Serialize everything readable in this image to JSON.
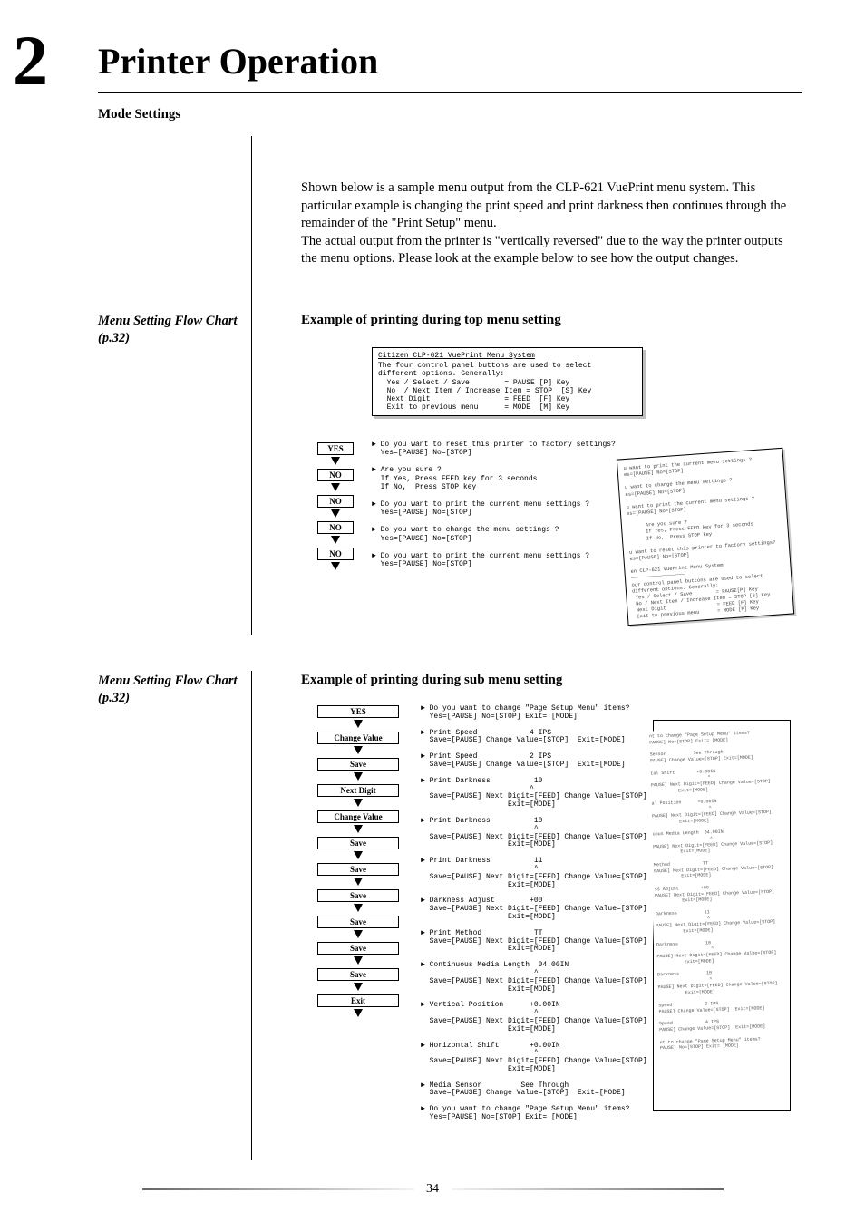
{
  "chapter_number": "2",
  "chapter_title": "Printer Operation",
  "section_title": "Mode Settings",
  "intro_para1": "Shown below is a sample menu output from the CLP-621 VuePrint menu system. This particular example is changing the print speed and print darkness then continues through the remainder of the \"Print Setup\" menu.",
  "intro_para2": "The actual output from the printer is \"vertically reversed\" due to the way the printer outputs the menu options. Please look at the example below to see how the output changes.",
  "sidebar_ref_top": "Menu Setting Flow Chart (p.32)",
  "sidebar_ref_bottom": "Menu Setting Flow Chart (p.32)",
  "example_heading_1": "Example of printing during top menu setting",
  "example_heading_2": "Example of printing during sub menu setting",
  "box1_title": "Citizen CLP-621 VuePrint Menu System",
  "box1_body": "The four control panel buttons are used to select\ndifferent options. Generally:\n  Yes / Select / Save        = PAUSE [P] Key\n  No  / Next Item / Increase Item = STOP  [S] Key\n  Next Digit                 = FEED  [F] Key\n  Exit to previous menu      = MODE  [M] Key",
  "d1_labels": [
    "YES",
    "NO",
    "NO",
    "NO",
    "NO"
  ],
  "d1_flow": [
    "Do you want to reset this printer to factory settings?\n  Yes=[PAUSE] No=[STOP]",
    "Are you sure ?\n  If Yes, Press FEED key for 3 seconds\n  If No,  Press STOP key",
    "Do you want to print the current menu settings ?\n  Yes=[PAUSE] No=[STOP]",
    "Do you want to change the menu settings ?\n  Yes=[PAUSE] No=[STOP]",
    "Do you want to print the current menu settings ?\n  Yes=[PAUSE] No=[STOP]"
  ],
  "d1_thumb": "u want to print the current menu settings ?\nes=[PAUSE] No=[STOP]\n\nu want to change the menu settings ?\nes=[PAUSE] No=[STOP]\n\nu want to print the current menu settings ?\nes=[PAUSE] No=[STOP]\n\n      Are you sure ?\n      If Yes, Press FEED key for 3 seconds\n      If No,  Press STOP key\n\nu want to reset this printer to factory settings?\nes=[PAUSE] No=[STOP]\n\nen CLP-621 VuePrint Menu System\n――――――――――――――――――\nour control panel buttons are used to select\ndifferent options. Generally:\n Yes / Select / Save        = PAUSE[P] Key\n No / Next Item / Increase Item = STOP [S] Key\n Next Digit                 = FEED [F] Key\n Exit to previous menu      = MODE [M] Key",
  "d2_labels": [
    "YES",
    "Change Value",
    "Save",
    "Next Digit",
    "Change Value",
    "Save",
    "Save",
    "Save",
    "Save",
    "Save",
    "Save",
    "Exit"
  ],
  "d2_flow": [
    "Do you want to change \"Page Setup Menu\" items?\n  Yes=[PAUSE] No=[STOP] Exit= [MODE]",
    "Print Speed            4 IPS\n  Save=[PAUSE] Change Value=[STOP]  Exit=[MODE]",
    "Print Speed            2 IPS\n  Save=[PAUSE] Change Value=[STOP]  Exit=[MODE]",
    "Print Darkness          10\n                         ^\n  Save=[PAUSE] Next Digit=[FEED] Change Value=[STOP]\n                    Exit=[MODE]",
    "Print Darkness          10\n                          ^\n  Save=[PAUSE] Next Digit=[FEED] Change Value=[STOP]\n                    Exit=[MODE]",
    "Print Darkness          11\n                          ^\n  Save=[PAUSE] Next Digit=[FEED] Change Value=[STOP]\n                    Exit=[MODE]",
    "Darkness Adjust        +00\n  Save=[PAUSE] Next Digit=[FEED] Change Value=[STOP]\n                    Exit=[MODE]",
    "Print Method            TT\n  Save=[PAUSE] Next Digit=[FEED] Change Value=[STOP]\n                    Exit=[MODE]",
    "Continuous Media Length  04.00IN\n                          ^\n  Save=[PAUSE] Next Digit=[FEED] Change Value=[STOP]\n                    Exit=[MODE]",
    "Vertical Position      +0.00IN\n                          ^\n  Save=[PAUSE] Next Digit=[FEED] Change Value=[STOP]\n                    Exit=[MODE]",
    "Horizontal Shift       +0.00IN\n                          ^\n  Save=[PAUSE] Next Digit=[FEED] Change Value=[STOP]\n                    Exit=[MODE]",
    "Media Sensor         See Through\n  Save=[PAUSE] Change Value=[STOP]  Exit=[MODE]",
    "Do you want to change \"Page Setup Menu\" items?\n  Yes=[PAUSE] No=[STOP] Exit= [MODE]"
  ],
  "d2_thumb": "nt to change \"Page Setup Menu\" items?\nPAUSE] No=[STOP] Exit= [MODE]\n\nSensor          See Through\nPAUSE] Change Value=[STOP] Exit=[MODE]\n\ntal Shift        +0.00IN\n                     ^\nPAUSE] Next Digit=[FEED] Change Value=[STOP]\n          Exit=[MODE]\n\nal Position      +0.00IN\n                     ^\nPAUSE] Next Digit=[FEED] Change Value=[STOP]\n          Exit=[MODE]\n\nuous Media Length  04.00IN\n                     ^\nPAUSE] Next Digit=[FEED] Change Value=[STOP]\n          Exit=[MODE]\n\nMethod            TT\nPAUSE] Next Digit=[FEED] Change Value=[STOP]\n          Exit=[MODE]\n\nss Adjust        +00\nPAUSE] Next Digit=[FEED] Change Value=[STOP]\n          Exit=[MODE]\n\nDarkness          11\n                   ^\nPAUSE] Next Digit=[FEED] Change Value=[STOP]\n          Exit=[MODE]\n\nDarkness          10\n                    ^\nPAUSE] Next Digit=[FEED] Change Value=[STOP]\n          Exit=[MODE]\n\nDarkness          10\n                   ^\nPAUSE] Next Digit=[FEED] Change Value=[STOP]\n          Exit=[MODE]\n\nSpeed            2 IPS\nPAUSE] Change Value=[STOP]  Exit=[MODE]\n\nSpeed            4 IPS\nPAUSE] Change Value=[STOP]  Exit=[MODE]\n\nnt to change \"Page Setup Menu\" items?\nPAUSE] No=[STOP] Exit= [MODE]",
  "page_number": "34"
}
